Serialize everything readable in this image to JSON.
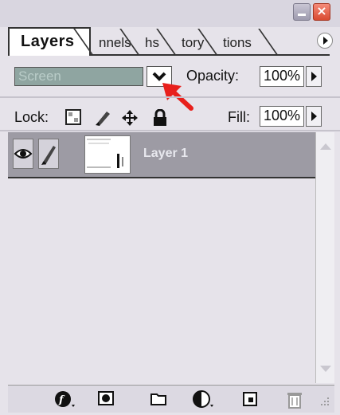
{
  "window": {
    "title": "",
    "buttons": {
      "minimize": "–",
      "close": "×"
    }
  },
  "tabs": [
    {
      "label": "Layers",
      "active": true
    },
    {
      "label": "nnels",
      "active": false
    },
    {
      "label": "hs",
      "active": false
    },
    {
      "label": "tory",
      "active": false
    },
    {
      "label": "tions",
      "active": false
    }
  ],
  "blend_mode": {
    "selected": "Screen"
  },
  "opacity": {
    "label": "Opacity:",
    "value": "100%"
  },
  "lock": {
    "label": "Lock:"
  },
  "fill": {
    "label": "Fill:",
    "value": "100%"
  },
  "layers": [
    {
      "name": "Layer 1",
      "visible": true,
      "selected": true
    }
  ],
  "colors": {
    "panel_bg": "#e6e3ea",
    "selected_row": "#9d9ba4",
    "blend_select_bg": "#8fa5a1",
    "annotation_arrow": "#e8201c"
  },
  "icons": {
    "lock_buttons": [
      "lock-transparency-icon",
      "lock-paint-icon",
      "lock-position-icon",
      "lock-all-icon"
    ],
    "bottom_buttons": [
      "layer-style-icon",
      "layer-mask-icon",
      "new-group-icon",
      "adjustment-layer-icon",
      "new-layer-icon",
      "trash-icon"
    ]
  }
}
